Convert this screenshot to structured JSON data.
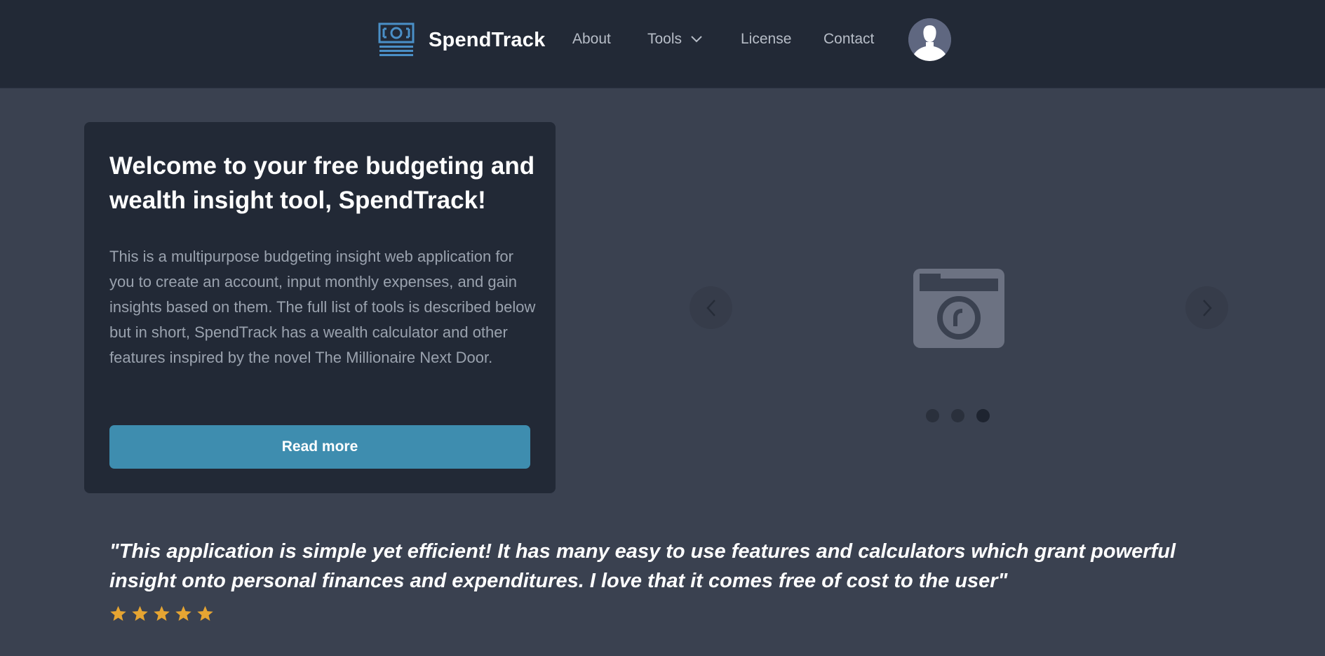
{
  "nav": {
    "brand": "SpendTrack",
    "links": {
      "about": "About",
      "tools": "Tools",
      "license": "License",
      "contact": "Contact"
    }
  },
  "hero": {
    "title": "Welcome to your free budgeting and wealth insight tool, SpendTrack!",
    "description": "This is a multipurpose budgeting insight web application for you to create an account, input monthly expenses, and gain insights based on them. The full list of tools is described below but in short, SpendTrack has a wealth calculator and other features inspired by the novel The Millionaire Next Door.",
    "button_label": "Read more"
  },
  "carousel": {
    "slide_count": 3,
    "active_index": 2,
    "image_icon": "camera-icon"
  },
  "testimonial": {
    "quote": "\"This application is simple yet efficient! It has many easy to use features and calculators which grant powerful insight onto personal finances and expenditures. I love that it comes free of cost to the user\"",
    "rating": 5,
    "rating_max": 5
  },
  "colors": {
    "navbar": "#222936",
    "background": "#3a4150",
    "card": "#222936",
    "accent_button": "#3e8daf",
    "logo_blue": "#4a8fc7",
    "star": "#e6a532"
  }
}
